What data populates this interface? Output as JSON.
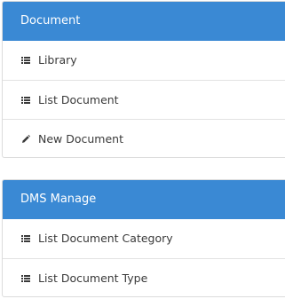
{
  "document_panel": {
    "title": "Document",
    "items": [
      {
        "label": "Library",
        "icon": "list-icon"
      },
      {
        "label": "List Document",
        "icon": "list-icon"
      },
      {
        "label": "New Document",
        "icon": "pencil-icon"
      }
    ]
  },
  "dms_panel": {
    "title": "DMS Manage",
    "items": [
      {
        "label": "List Document Category",
        "icon": "list-icon"
      },
      {
        "label": "List Document Type",
        "icon": "list-icon"
      }
    ]
  },
  "colors": {
    "header_bg": "#3a89d4",
    "header_text": "#ffffff",
    "item_text": "#3a3a3a",
    "border": "#dcdcdc"
  }
}
